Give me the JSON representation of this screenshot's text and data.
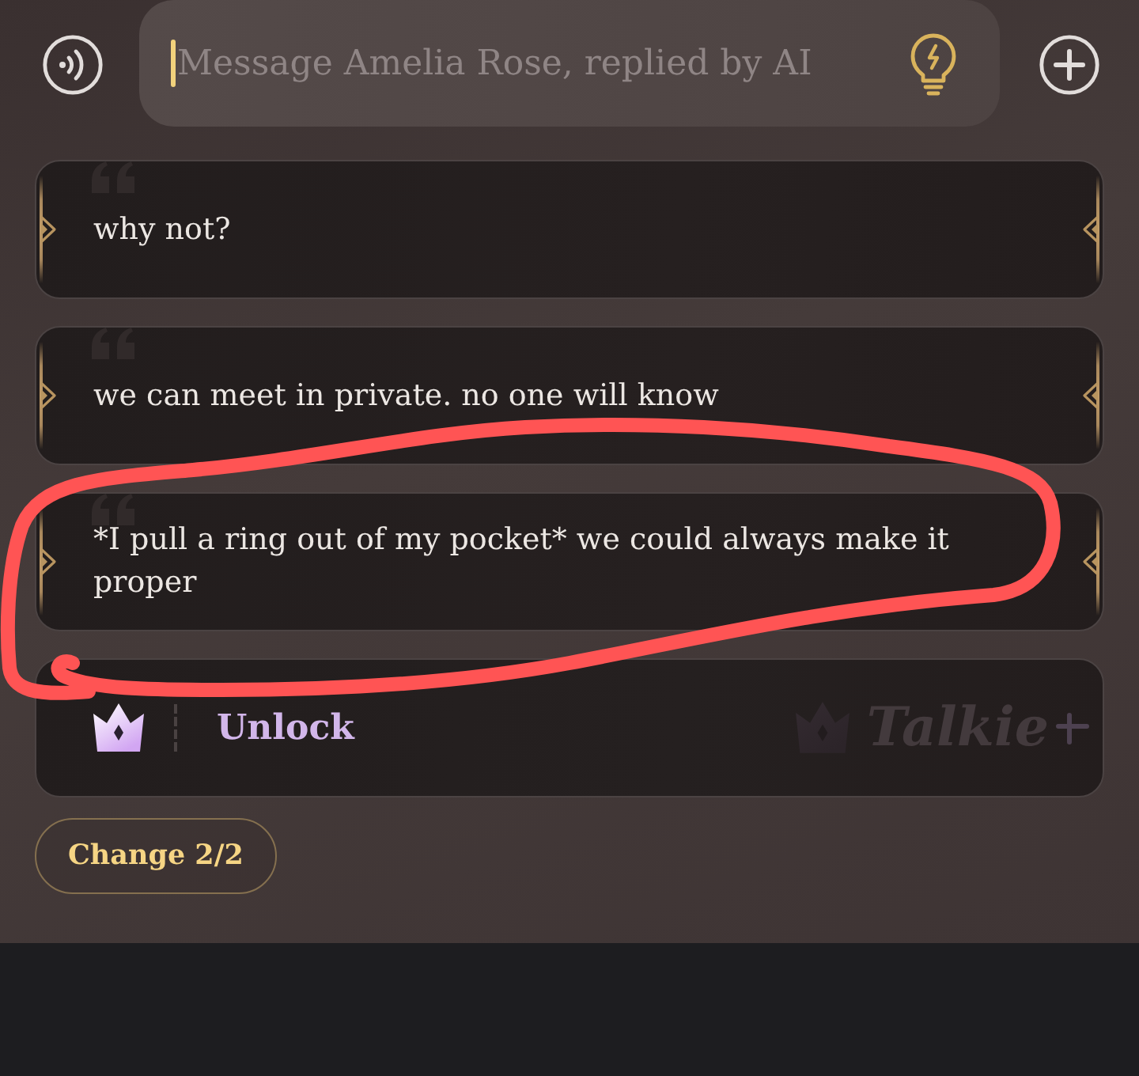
{
  "composer": {
    "placeholder": "Message Amelia Rose, replied by AI"
  },
  "suggestions": [
    {
      "text": "why not?"
    },
    {
      "text": "we can meet in private. no one will know"
    },
    {
      "text": "*I pull a ring out of my pocket* we could always make it proper"
    }
  ],
  "unlock": {
    "label": "Unlock",
    "brand": "Talkie"
  },
  "change_button": {
    "label": "Change 2/2"
  }
}
